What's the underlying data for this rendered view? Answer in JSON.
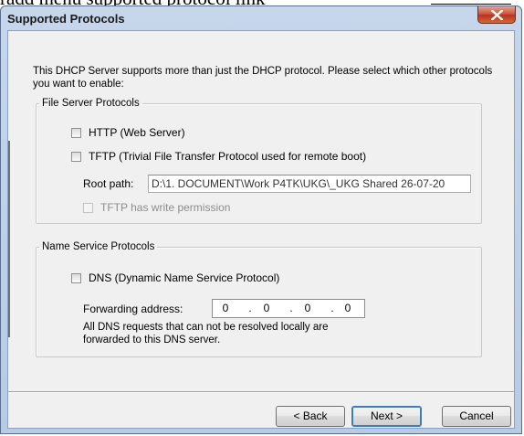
{
  "background_header": {
    "text": "radd menu supported protocol link"
  },
  "dialog": {
    "title": "Supported Protocols",
    "intro_text": "This DHCP Server supports more than just the DHCP protocol. Please select which other protocols you want to enable:",
    "file_server_group": {
      "legend": "File Server Protocols",
      "http_label": "HTTP (Web Server)",
      "http_checked": false,
      "tftp_label": "TFTP (Trivial File Transfer Protocol used for remote boot)",
      "tftp_checked": false,
      "root_path_label": "Root path:",
      "root_path_value": "D:\\1. DOCUMENT\\Work P4TK\\UKG\\_UKG Shared 26-07-20",
      "tftp_write_label": "TFTP has write permission",
      "tftp_write_checked": false,
      "tftp_write_enabled": false
    },
    "name_service_group": {
      "legend": "Name Service Protocols",
      "dns_label": "DNS (Dynamic Name Service Protocol)",
      "dns_checked": false,
      "forwarding_label": "Forwarding address:",
      "forwarding_address": [
        "0",
        "0",
        "0",
        "0"
      ],
      "dns_note": "All DNS requests that can not be resolved locally are forwarded to this DNS server."
    },
    "buttons": {
      "back": "< Back",
      "next": "Next >",
      "cancel": "Cancel"
    }
  },
  "colors": {
    "frame": "#b9cde5",
    "client": "#f0f0f0",
    "close_button": "#c7462d",
    "default_button_border": "#3c7fb1"
  }
}
